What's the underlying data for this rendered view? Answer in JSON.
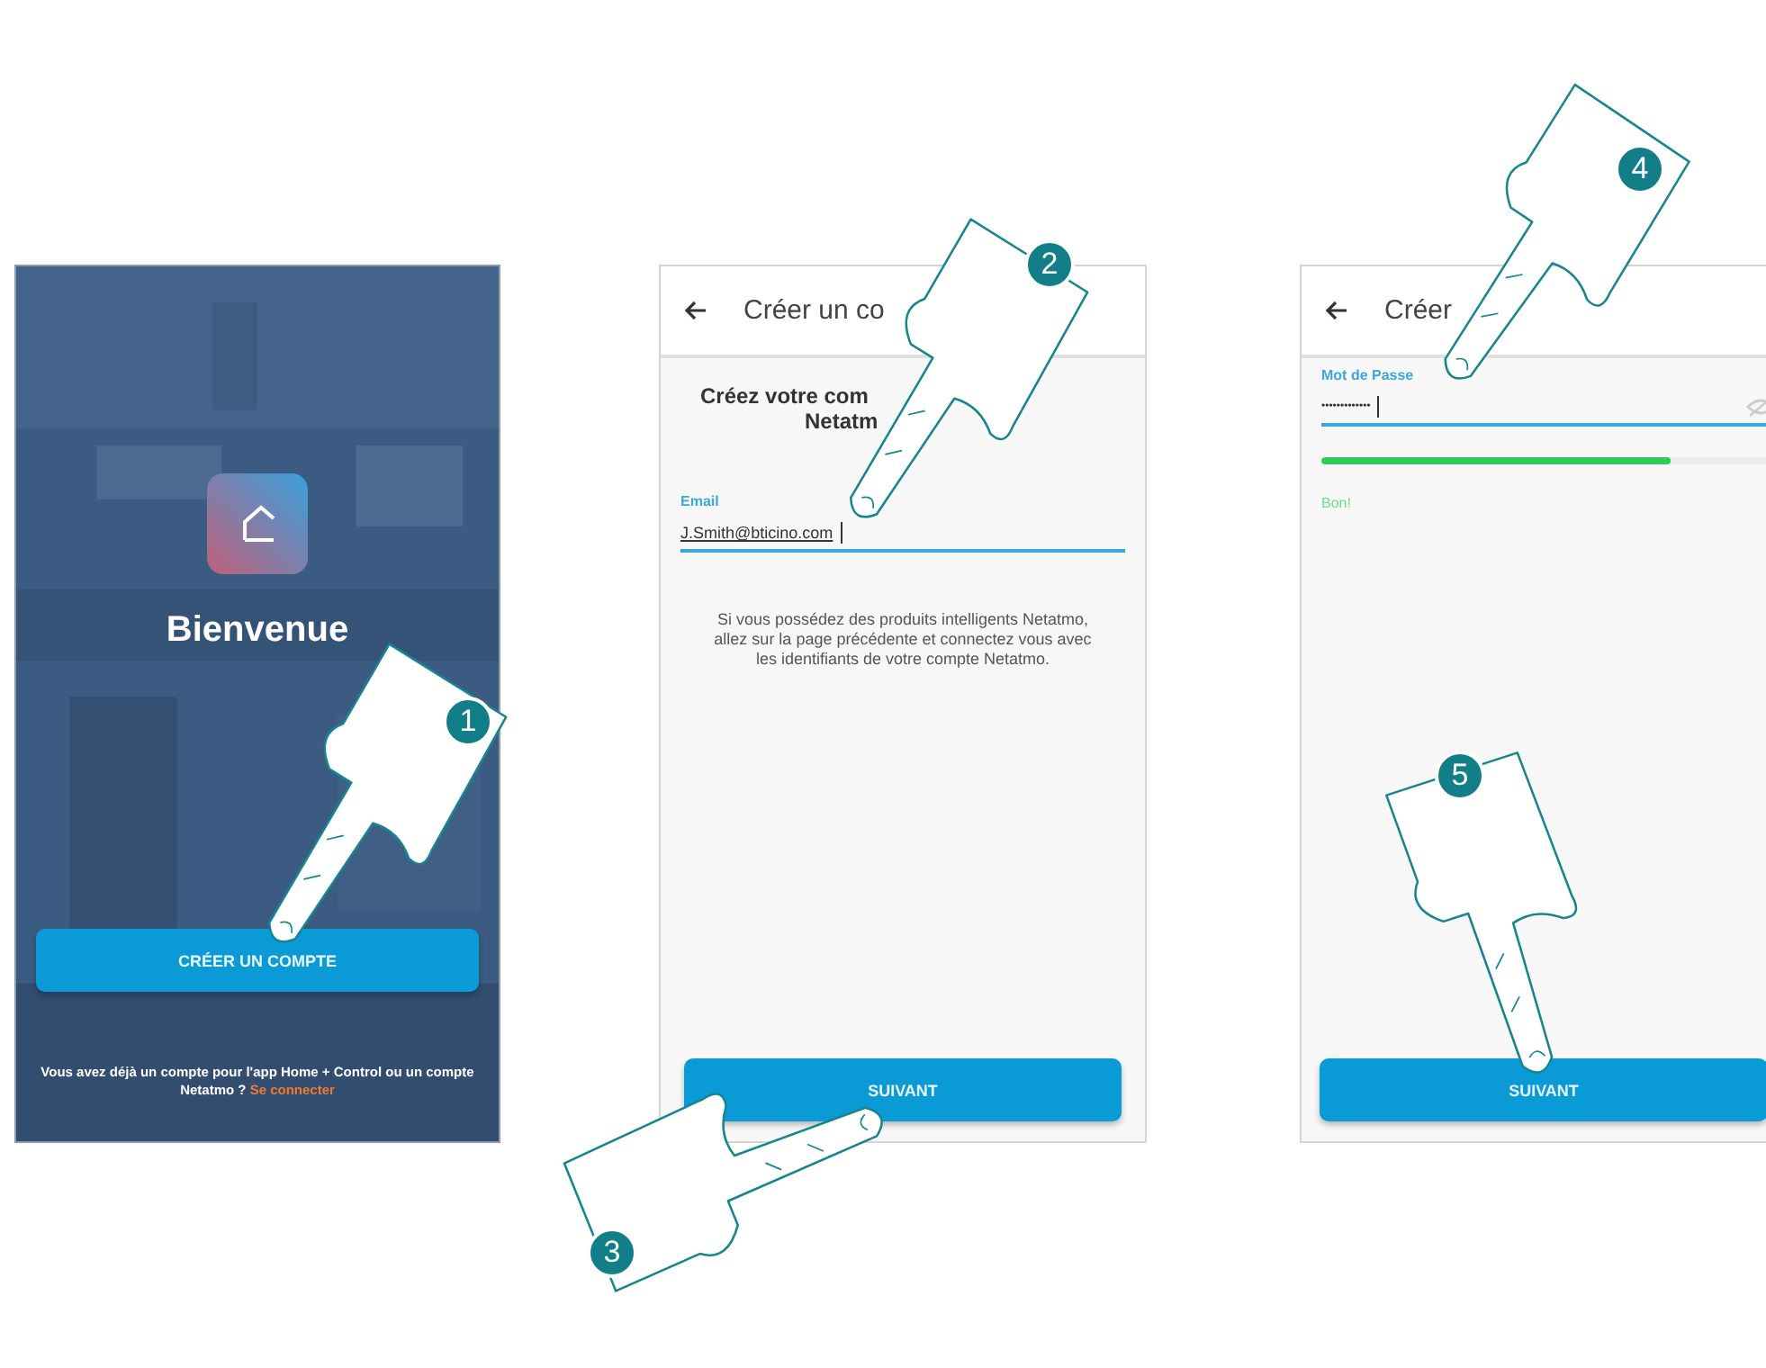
{
  "screens": [
    {
      "kind": "welcome",
      "title": "Bienvenue",
      "button": "CRÉER UN COMPTE",
      "footer": "Vous avez déjà un compte pour l'app Home + Control ou un compte Netatmo ?",
      "footer_link": "Se connecter"
    },
    {
      "kind": "email",
      "header": "Créer un co",
      "heading_lines": [
        "Créez votre com",
        "Netatm"
      ],
      "field": {
        "label": "Email",
        "value": "J.Smith@bticino.com"
      },
      "info": "Si vous possédez des produits intelligents Netatmo, allez sur la page précédente et connectez vous avec les identifiants de votre compte Netatmo.",
      "button": "SUIVANT"
    },
    {
      "kind": "password",
      "header": "Créer",
      "field": {
        "label": "Mot de Passe",
        "value": "•••••••••••••"
      },
      "strength": {
        "level": 0.75,
        "text": "Bon!"
      },
      "button": "SUIVANT"
    }
  ],
  "steps": [
    "1",
    "2",
    "3",
    "4",
    "5"
  ]
}
